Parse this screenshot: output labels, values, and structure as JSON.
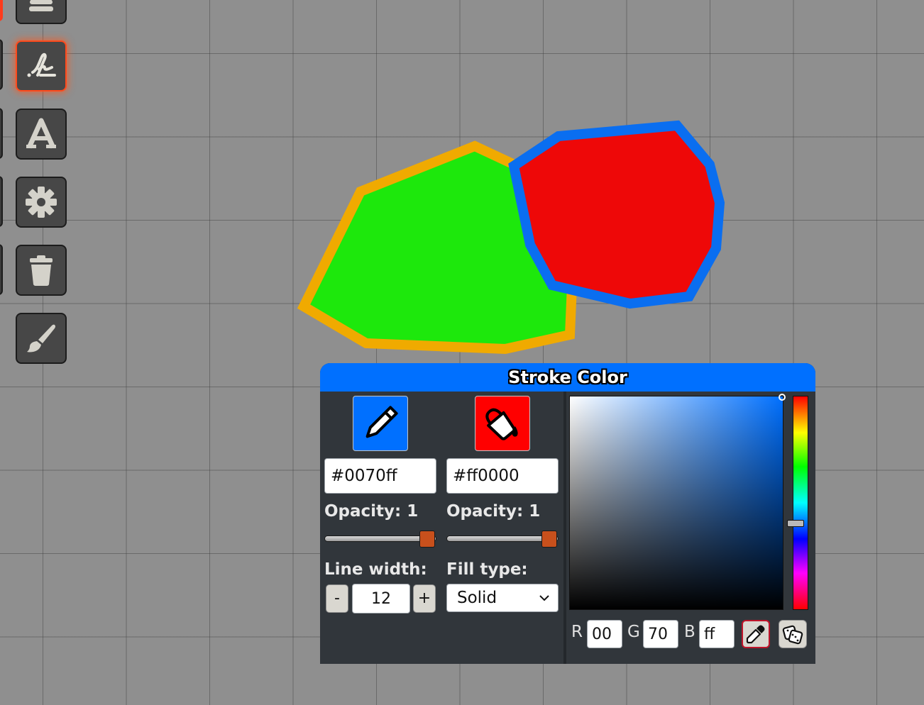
{
  "canvas": {
    "shapes": [
      {
        "name": "green-polygon",
        "fill": "#1de80c",
        "stroke": "#f0aa00"
      },
      {
        "name": "red-polygon",
        "fill": "#ee0808",
        "stroke": "#0a6ef0"
      }
    ]
  },
  "toolbar": {
    "tools": [
      {
        "name": "polygon-tool-button",
        "icon": "polygon-icon",
        "active": false
      },
      {
        "name": "freehand-tool-button",
        "icon": "signature-icon",
        "active": true
      },
      {
        "name": "text-tool-button",
        "icon": "text-icon",
        "active": false
      },
      {
        "name": "settings-button",
        "icon": "gear-icon",
        "active": false
      },
      {
        "name": "delete-button",
        "icon": "trash-icon",
        "active": false
      },
      {
        "name": "paint-tool-button",
        "icon": "brush-icon",
        "active": false
      }
    ]
  },
  "color_panel": {
    "title": "Stroke Color",
    "stroke": {
      "icon": "pencil-icon",
      "color": "#0070ff",
      "hex": "#0070ff",
      "opacity_label": "Opacity: 1",
      "opacity": 1
    },
    "fill": {
      "icon": "paint-bucket-icon",
      "color": "#ff0000",
      "hex": "#ff0000",
      "opacity_label": "Opacity: 1",
      "opacity": 1
    },
    "line_width_label": "Line width:",
    "line_width": "12",
    "decrement_label": "-",
    "increment_label": "+",
    "fill_type_label": "Fill type:",
    "fill_type": "Solid",
    "picker": {
      "r_label": "R",
      "r": "00",
      "g_label": "G",
      "g": "70",
      "b_label": "B",
      "b": "ff",
      "hue_level": 0.6
    },
    "accent_orange": "#c8501c",
    "header_color": "#0070ff"
  }
}
